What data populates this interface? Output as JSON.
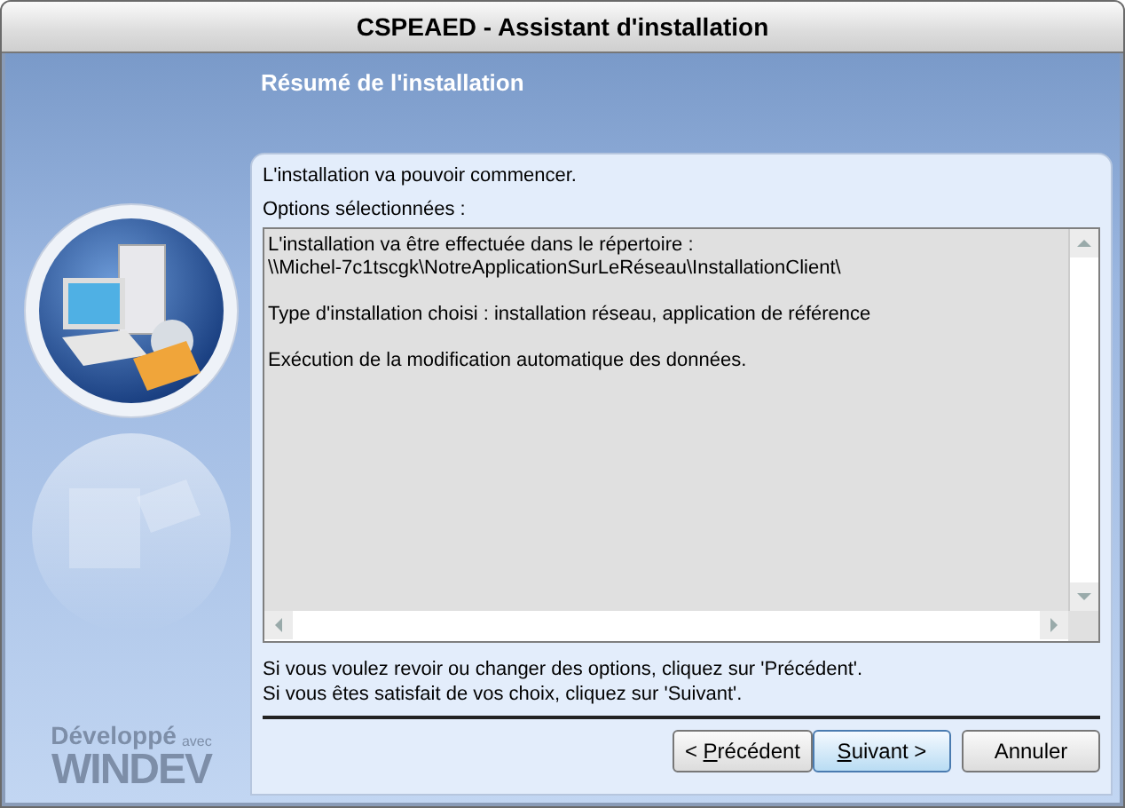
{
  "window": {
    "title": "CSPEAED - Assistant d'installation"
  },
  "header": {
    "title": "Résumé de l'installation"
  },
  "intro": "L'installation va pouvoir commencer.",
  "options_label": "Options sélectionnées :",
  "summary_paragraphs": [
    [
      "L'installation va être effectuée dans le répertoire :",
      "\\\\Michel-7c1tscgk\\NotreApplicationSurLeRéseau\\InstallationClient\\"
    ],
    [
      "Type d'installation choisi : installation réseau, application de référence"
    ],
    [
      "Exécution de la modification automatique des données."
    ]
  ],
  "hints": [
    "Si vous voulez revoir ou changer des options, cliquez sur 'Précédent'.",
    "Si vous êtes satisfait de vos choix, cliquez sur 'Suivant'."
  ],
  "buttons": [
    {
      "before": "< ",
      "key": "P",
      "after": "récédent",
      "default": false
    },
    {
      "key": "S",
      "after": "uivant >",
      "default": true
    },
    {
      "after": "Annuler",
      "default": false
    }
  ],
  "logo": {
    "top": "Développé",
    "small": "avec",
    "brand": "WINDEV"
  }
}
